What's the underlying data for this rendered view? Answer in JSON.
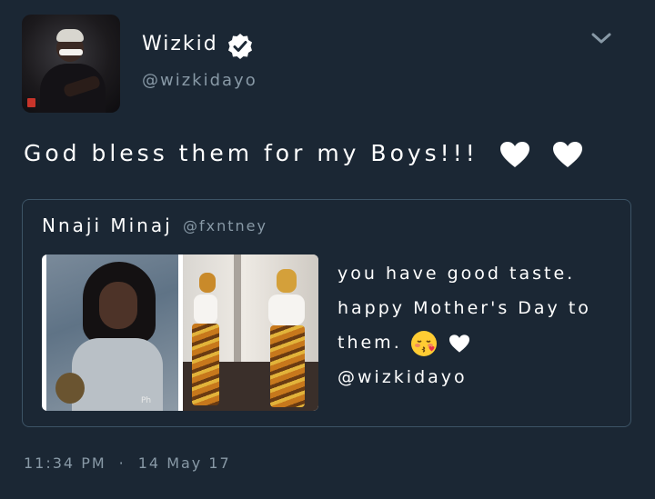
{
  "tweet": {
    "author": {
      "display_name": "Wizkid",
      "handle": "@wizkidayo",
      "verified_icon": "verified-badge-icon"
    },
    "menu_icon": "chevron-down-icon",
    "text": "God bless them for my Boys!!!",
    "text_emoji": [
      "heart-icon",
      "heart-icon"
    ],
    "quoted": {
      "display_name": "Nnaji Minaj",
      "handle": "@fxntney",
      "text_line1": "you have good taste.",
      "text_line2": "happy Mother's Day to",
      "text_line3_start": "them.",
      "text_emoji": [
        "kissing-face-icon",
        "heart-icon"
      ],
      "mention": "@wizkidayo",
      "image_watermark": "Ph"
    },
    "time": "11:34 PM",
    "separator": "·",
    "date": "14 May 17"
  },
  "colors": {
    "background": "#1b2734",
    "text_primary": "#ffffff",
    "text_secondary": "#8899a6",
    "border": "#3d5466",
    "emoji_face": "#ffcc33"
  }
}
